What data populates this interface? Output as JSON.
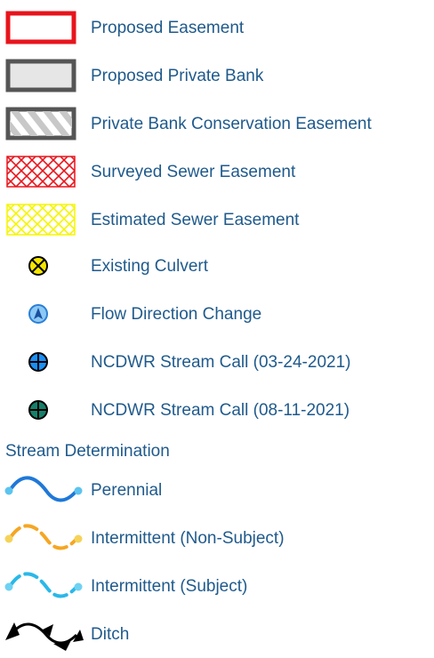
{
  "legend": {
    "items": [
      {
        "label": "Proposed Easement",
        "icon": "red-outline-rectangle-icon",
        "color": "#e8141c"
      },
      {
        "label": "Proposed Private Bank",
        "icon": "gray-filled-rectangle-icon",
        "color": "#5a5a5a"
      },
      {
        "label": "Private Bank Conservation Easement",
        "icon": "gray-hatched-rectangle-icon",
        "color": "#5a5a5a"
      },
      {
        "label": "Surveyed Sewer Easement",
        "icon": "red-crosshatch-icon",
        "color": "#e8141c"
      },
      {
        "label": "Estimated Sewer Easement",
        "icon": "yellow-crosshatch-icon",
        "color": "#f5f500"
      },
      {
        "label": "Existing Culvert",
        "icon": "yellow-x-circle-icon",
        "color": "#f5e600"
      },
      {
        "label": "Flow Direction Change",
        "icon": "blue-arrow-circle-icon",
        "color": "#4aa8f0"
      },
      {
        "label": "NCDWR Stream Call (03-24-2021)",
        "icon": "blue-crosshair-circle-icon",
        "color": "#1a8ff5"
      },
      {
        "label": "NCDWR Stream Call (08-11-2021)",
        "icon": "green-crosshair-circle-icon",
        "color": "#16806a"
      }
    ],
    "stream_heading": "Stream Determination",
    "streams": [
      {
        "label": "Perennial",
        "icon": "perennial-stream-icon",
        "color": "#1f78d8",
        "endpoint_color": "#5cc4ee"
      },
      {
        "label": "Intermittent (Non-Subject)",
        "icon": "intermittent-nonsubject-stream-icon",
        "color": "#f5a623",
        "endpoint_color": "#f5d35a"
      },
      {
        "label": "Intermittent (Subject)",
        "icon": "intermittent-subject-stream-icon",
        "color": "#2ab8e8",
        "endpoint_color": "#6fd2f2"
      },
      {
        "label": "Ditch",
        "icon": "ditch-icon",
        "color": "#000000"
      }
    ]
  }
}
